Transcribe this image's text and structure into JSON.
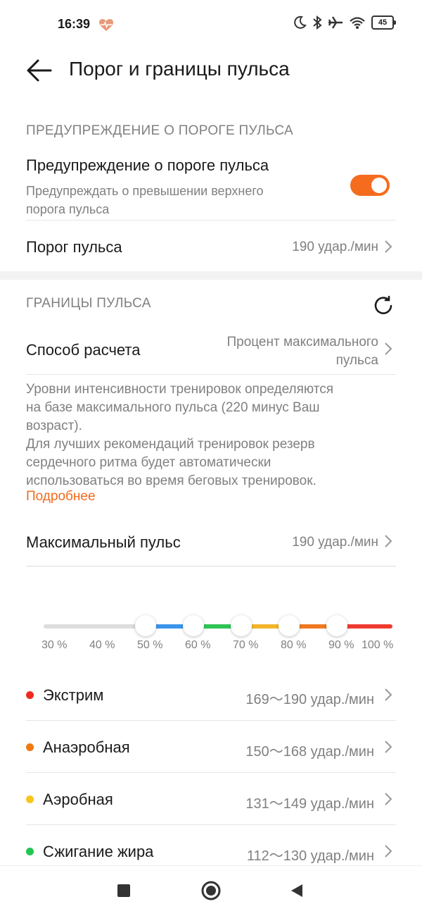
{
  "status_bar": {
    "time": "16:39",
    "battery": "45"
  },
  "header": {
    "title": "Порог и границы пульса"
  },
  "section_warning": {
    "heading": "ПРЕДУПРЕЖДЕНИЕ О ПОРОГЕ ПУЛЬСА"
  },
  "warning_toggle": {
    "title": "Предупреждение о пороге пульса",
    "subtitle_line1": "Предупреждать о превышении верхнего",
    "subtitle_line2": "порога пульса",
    "enabled": true,
    "color": "#f56c1f"
  },
  "threshold": {
    "label": "Порог пульса",
    "value": "190 удар./мин"
  },
  "section_limits": {
    "heading": "ГРАНИЦЫ ПУЛЬСА"
  },
  "method": {
    "label": "Способ расчета",
    "value_line1": "Процент максимального",
    "value_line2": "пульса"
  },
  "description": {
    "line1": "Уровни интенсивности тренировок определяются",
    "line2": "на базе максимального пульса (220 минус Ваш",
    "line3": "возраст).",
    "line4": "Для лучших рекомендаций тренировок резерв",
    "line5": "сердечного ритма будет автоматически",
    "line6": "использоваться во время беговых тренировок.",
    "more_link": "Подробнее"
  },
  "max_pulse": {
    "label": "Максимальный пульс",
    "value": "190 удар./мин"
  },
  "slider": {
    "ticks": [
      "30 %",
      "40 %",
      "50 %",
      "60 %",
      "70 %",
      "80 %",
      "90 %",
      "100 %"
    ],
    "segment_colors": [
      "#dddddd",
      "#dddddd",
      "#3a95ea",
      "#2fc455",
      "#f2b52a",
      "#ef7a22",
      "#ef3b2f"
    ]
  },
  "zones": [
    {
      "name": "Экстрим",
      "range": "169～190 удар./мин",
      "color": "#ee2a1f"
    },
    {
      "name": "Анаэробная",
      "range": "150～168 удар./мин",
      "color": "#ef7a10"
    },
    {
      "name": "Аэробная",
      "range": "131～149 удар./мин",
      "color": "#f7c61e"
    },
    {
      "name": "Сжигание жира",
      "range": "112～130 удар./мин",
      "color": "#21c653"
    }
  ]
}
